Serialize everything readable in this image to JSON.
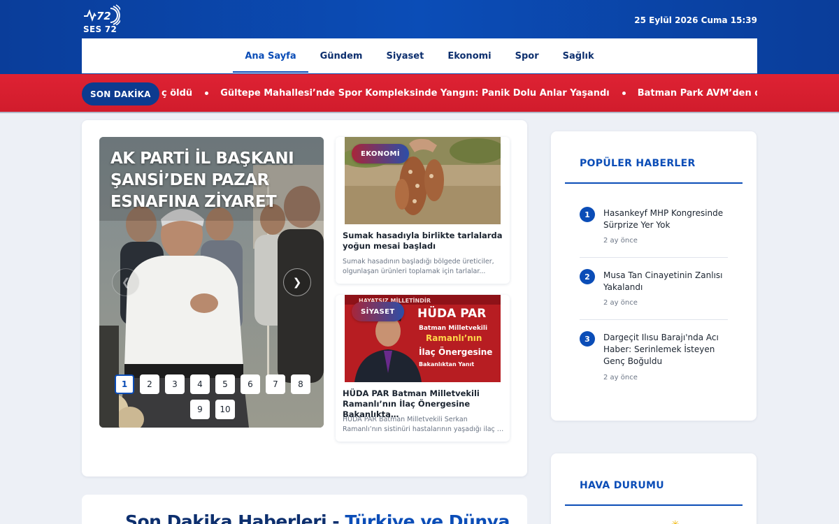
{
  "header": {
    "logo_text": "SES 72",
    "logo_mark": "72",
    "datetime": "25 Eylül 2026 Cuma 15:39"
  },
  "nav": {
    "items": [
      {
        "label": "Ana Sayfa",
        "active": true
      },
      {
        "label": "Gündem"
      },
      {
        "label": "Siyaset"
      },
      {
        "label": "Ekonomi"
      },
      {
        "label": "Spor"
      },
      {
        "label": "Sağlık"
      }
    ]
  },
  "ticker": {
    "badge": "SON DAKİKA",
    "items": [
      "ç öldü",
      "Gültepe Mahallesi’nde Spor Kompleksinde Yangın: Panik Dolu Anlar Yaşandı",
      "Batman Park AVM’den deprem bölgesin"
    ]
  },
  "slider": {
    "title": "AK PARTİ İL BAŞKANI ŞANSİ’DEN PAZAR ESNAFINA ZİYARET",
    "prev_icon": "chevron-left-icon",
    "next_icon": "chevron-right-icon",
    "pages": [
      "1",
      "2",
      "3",
      "4",
      "5",
      "6",
      "7",
      "8",
      "9",
      "10"
    ],
    "active_page": "1"
  },
  "side_news": [
    {
      "category": "EKONOMİ",
      "title": "Sumak hasadıyla birlikte tarlalarda yoğun mesai başladı",
      "desc_line1": "Sumak hasadının başladığı bölgede üreticiler,",
      "desc_line2": "olgunlaşan ürünleri toplamak için tarlalar..."
    },
    {
      "category": "SİYASET",
      "title": "HÜDA PAR Batman Milletvekili Ramanlı’nın İlaç Önergesine Bakanlıkta…",
      "desc_line1": "HÜDA PAR Batman Milletvekili Serkan",
      "desc_line2": "Ramanlı’nın sistinüri hastalarının yaşadığı ilaç te...",
      "image_text": {
        "top": "HAYATSIZ MİLLETİNDİR",
        "line1": "HÜDA PAR",
        "line2": "Batman Milletvekili",
        "line3": "Ramanlı’nın",
        "line4": "İlaç Önergesine",
        "line5": "Bakanlıktan Yanıt"
      }
    }
  ],
  "bottom": {
    "title_part1": "Son Dakika Haberleri - ",
    "title_part2": "Türkiye ve Dünya"
  },
  "popular": {
    "title": "POPÜLER HABERLER",
    "items": [
      {
        "num": "1",
        "line1": "Hasankeyf MHP Kongresinde",
        "line2": "Sürprize Yer Yok",
        "ago": "2 ay önce"
      },
      {
        "num": "2",
        "line1": "Musa Tan Cinayetinin Zanlısı",
        "line2": "Yakalandı",
        "ago": "2 ay önce"
      },
      {
        "num": "3",
        "line1": "Dargeçit Ilısu Barajı'nda Acı",
        "line2": "Haber: Serinlemek İsteyen",
        "line3": "Genç Boğuldu",
        "ago": "2 ay önce"
      }
    ]
  },
  "weather": {
    "title": "HAVA DURUMU",
    "icon": "sun-icon"
  },
  "colors": {
    "brand_blue": "#0b4db7",
    "breaking_red": "#d11c2c",
    "navy": "#0d2f6e"
  }
}
